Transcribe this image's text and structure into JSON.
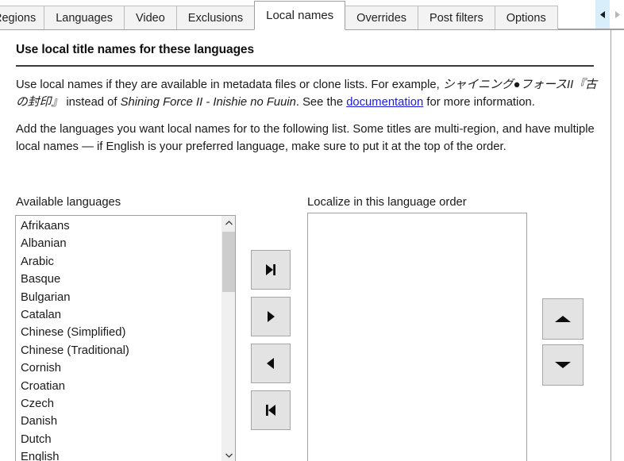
{
  "window": {
    "active_tab": "Local names"
  },
  "tabs": {
    "items": [
      {
        "label": "Regions",
        "active": false,
        "truncated": true
      },
      {
        "label": "Languages",
        "active": false,
        "truncated": false
      },
      {
        "label": "Video",
        "active": false,
        "truncated": false
      },
      {
        "label": "Exclusions",
        "active": false,
        "truncated": false
      },
      {
        "label": "Local names",
        "active": true,
        "truncated": false
      },
      {
        "label": "Overrides",
        "active": false,
        "truncated": false
      },
      {
        "label": "Post filters",
        "active": false,
        "truncated": false
      },
      {
        "label": "Options",
        "active": false,
        "truncated": false
      }
    ],
    "nav": {
      "prev_icon": "triangle-left-icon",
      "next_icon": "triangle-right-icon",
      "prev_state": "hover",
      "next_state": "disabled"
    }
  },
  "content": {
    "heading": "Use local title names for these languages",
    "paragraph1": {
      "part1": "Use local names if they are available in metadata files or clone lists. For example, ",
      "japanese_example": "シャイニング●フォースII『古の封印』",
      "part2": " instead of ",
      "romanized_example": "Shining Force II - Inishie no Fuuin",
      "part3": ". See the ",
      "link": "documentation",
      "part4": " for more information."
    },
    "paragraph2": "Add the languages you want local names for to the following list. Some titles are multi-region, and have multiple local names — if English is your preferred language, make sure to put it at the top of the order."
  },
  "available_list": {
    "label": "Available languages",
    "items": [
      "Afrikaans",
      "Albanian",
      "Arabic",
      "Basque",
      "Bulgarian",
      "Catalan",
      "Chinese (Simplified)",
      "Chinese (Traditional)",
      "Cornish",
      "Croatian",
      "Czech",
      "Danish",
      "Dutch",
      "English"
    ],
    "scrollbar": {
      "up_icon": "chevron-up-icon",
      "down_icon": "chevron-down-icon"
    }
  },
  "ordered_list": {
    "label": "Localize in this language order",
    "items": []
  },
  "transfer_buttons": [
    {
      "name": "move-all-right-button",
      "icon": "skip-forward-icon"
    },
    {
      "name": "move-right-button",
      "icon": "play-right-icon"
    },
    {
      "name": "move-left-button",
      "icon": "play-left-icon"
    },
    {
      "name": "move-all-left-button",
      "icon": "skip-back-icon"
    }
  ],
  "order_buttons": [
    {
      "name": "move-up-button",
      "icon": "triangle-up-icon"
    },
    {
      "name": "move-down-button",
      "icon": "triangle-down-icon"
    }
  ],
  "colors": {
    "link": "#1a1ae0",
    "tab_inactive_bg": "#f3f3f3",
    "tab_active_bg": "#ffffff",
    "button_face": "#e3e3e3",
    "border": "#a0a0a0",
    "scroll_thumb": "#cdcdcd",
    "tabnav_hover": "#d9eefb"
  }
}
